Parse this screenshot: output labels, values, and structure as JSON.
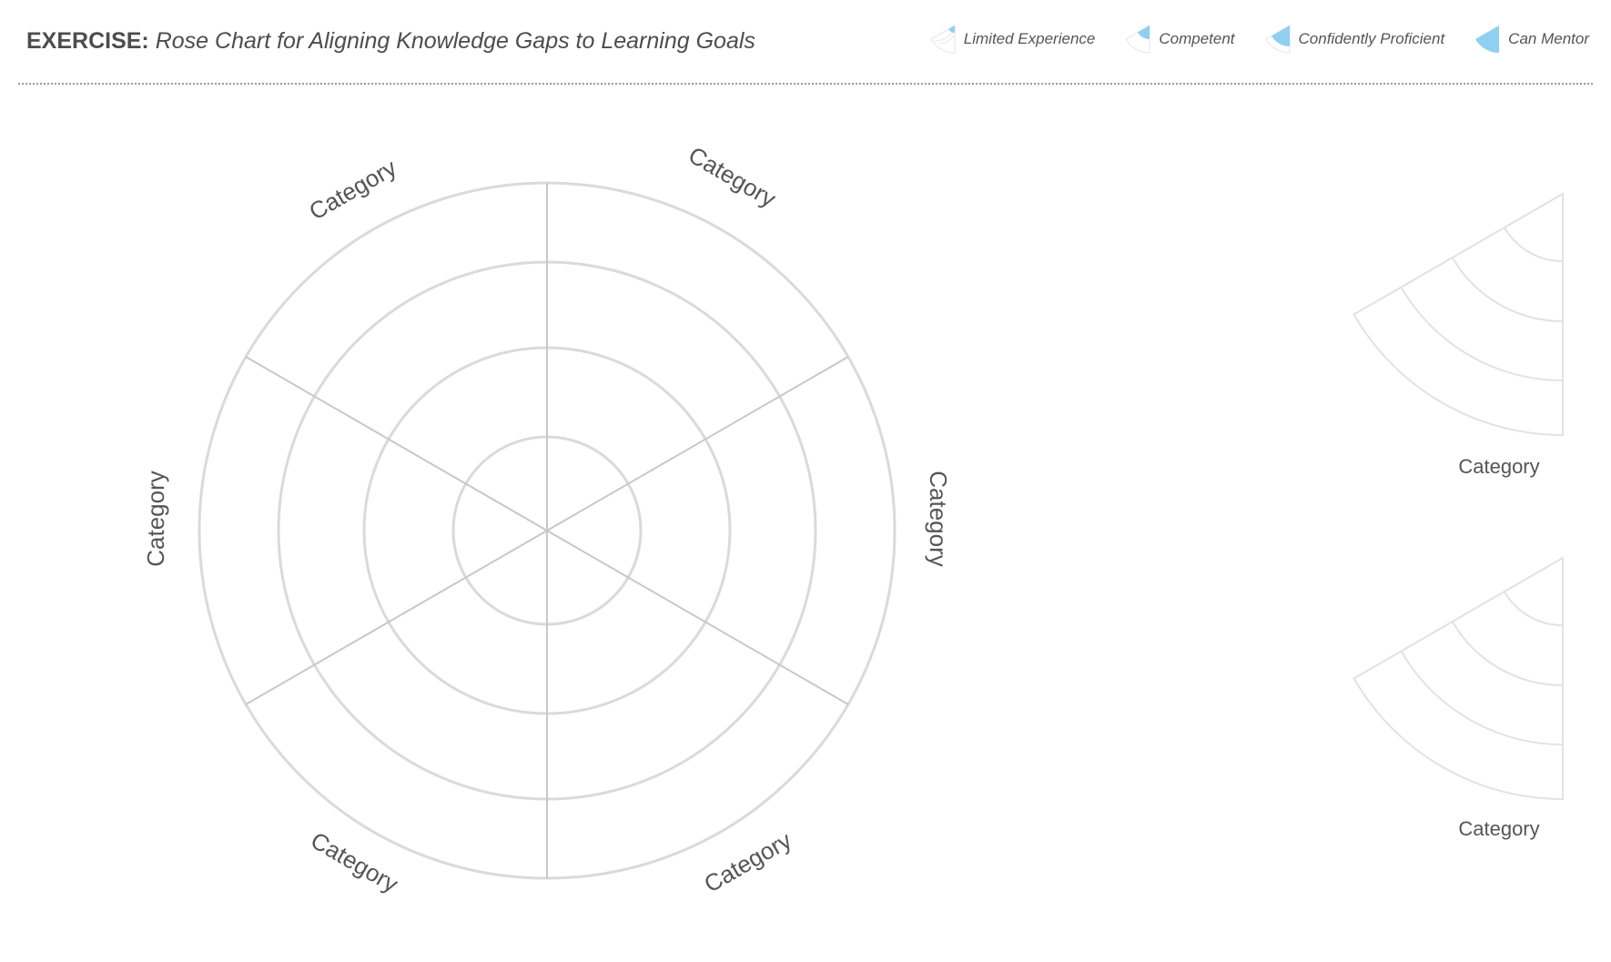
{
  "header": {
    "title_prefix": "EXERCISE:",
    "title_text": "Rose Chart for Aligning Knowledge Gaps to Learning Goals"
  },
  "legend": [
    {
      "label": "Limited Experience",
      "level": 1
    },
    {
      "label": "Competent",
      "level": 2
    },
    {
      "label": "Confidently Proficient",
      "level": 3
    },
    {
      "label": "Can Mentor",
      "level": 4
    }
  ],
  "colors": {
    "accent": "#8fcff2",
    "grid": "#d9d9d9",
    "spoke": "#c8c8c8",
    "text": "#555555"
  },
  "rose": {
    "category_labels": [
      "Category",
      "Category",
      "Category",
      "Category",
      "Category",
      "Category"
    ]
  },
  "wedges": [
    {
      "label": "Category"
    },
    {
      "label": "Category"
    }
  ]
}
